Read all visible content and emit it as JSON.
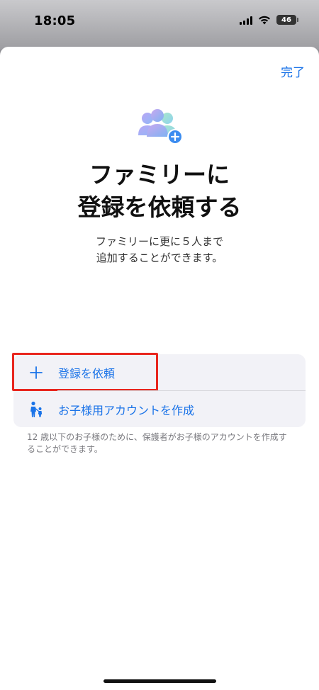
{
  "status_bar": {
    "time": "18:05",
    "battery_level": "46"
  },
  "header": {
    "done_label": "完了"
  },
  "hero": {
    "icon": "family-add-icon",
    "title_line1": "ファミリーに",
    "title_line2": "登録を依頼する",
    "subtitle_line1": "ファミリーに更に５人まで",
    "subtitle_line2": "追加することができます。"
  },
  "options": [
    {
      "icon": "plus-icon",
      "label": "登録を依頼"
    },
    {
      "icon": "parent-child-icon",
      "label": "お子様用アカウントを作成"
    }
  ],
  "footnote": "12 歳以下のお子様のために、保護者がお子様のアカウントを作成することができます。",
  "colors": {
    "accent": "#1a73e8",
    "highlight": "#e8261e",
    "group_bg": "#f2f2f7"
  }
}
